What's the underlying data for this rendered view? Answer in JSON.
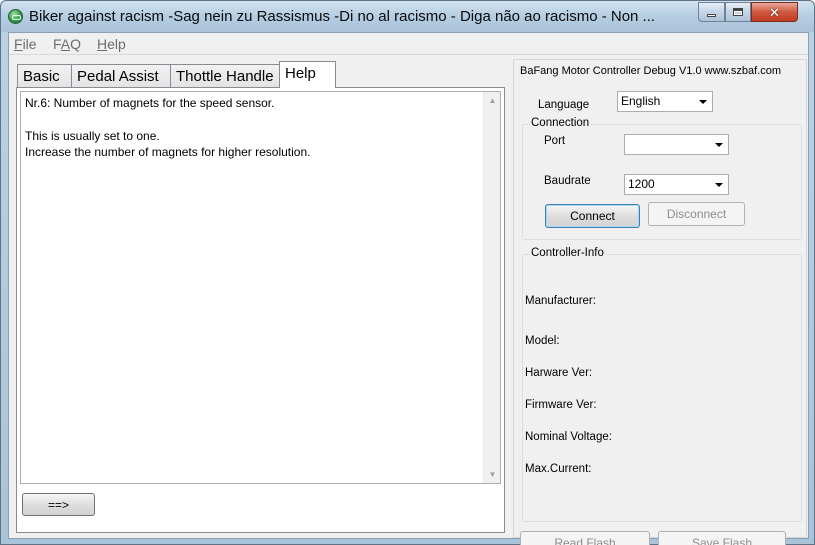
{
  "window": {
    "title": "Biker against racism -Sag nein zu Rassismus  -Di no al racismo - Diga não ao racismo - Non ..."
  },
  "menu": {
    "file": {
      "mnemonic": "F",
      "rest": "ile"
    },
    "faq": {
      "pre": "F",
      "mnemonic": "A",
      "rest": "Q"
    },
    "help": {
      "mnemonic": "H",
      "rest": "elp"
    }
  },
  "tabs": [
    {
      "label": "Basic"
    },
    {
      "label": "Pedal Assist"
    },
    {
      "label": "Thottle Handle"
    },
    {
      "label": "Help"
    }
  ],
  "help_text": {
    "line1": "Nr.6: Number of magnets for the speed sensor.",
    "line2": "This is usually set to one.",
    "line3": "Increase the number of magnets for higher resolution."
  },
  "next_button": "==>",
  "right": {
    "header": "BaFang Motor  Controller Debug V1.0  www.szbaf.com",
    "language_label": "Language",
    "language_value": "English",
    "connection_title": "Connection",
    "port_label": "Port",
    "port_value": "",
    "baudrate_label": "Baudrate",
    "baudrate_value": "1200",
    "connect_button": "Connect",
    "disconnect_button": "Disconnect",
    "info_title": "Controller-Info",
    "manufacturer_label": "Manufacturer:",
    "model_label": "Model:",
    "hardware_label": "Harware Ver:",
    "firmware_label": "Firmware Ver:",
    "voltage_label": "Nominal Voltage:",
    "current_label": "Max.Current:",
    "read_flash_button": "Read Flash",
    "save_flash_button": "Save Flash"
  }
}
